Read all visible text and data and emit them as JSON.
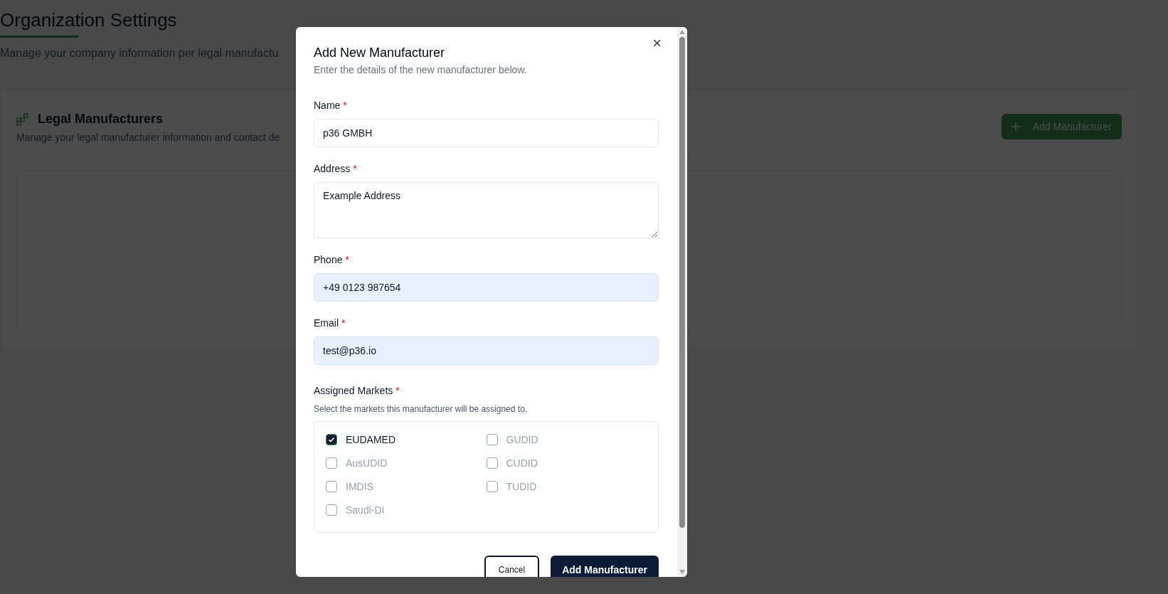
{
  "page": {
    "title": "Organization Settings",
    "subtitle": "Manage your company information per legal manufactu"
  },
  "card": {
    "title": "Legal Manufacturers",
    "subtitle": "Manage your legal manufacturer information and contact de",
    "button": "Add Manufacturer"
  },
  "dialog": {
    "title": "Add New Manufacturer",
    "subtitle": "Enter the details of the new manufacturer below.",
    "close": "×",
    "fields": [
      {
        "kind": "input",
        "label": "Name",
        "required_mark": "*",
        "value": "p36 GMBH",
        "autofilled": false
      },
      {
        "kind": "textarea",
        "label": "Address",
        "required_mark": "*",
        "value": "Example Address",
        "autofilled": false
      },
      {
        "kind": "input",
        "label": "Phone",
        "required_mark": "*",
        "value": "+49 0123 987654",
        "autofilled": true
      },
      {
        "kind": "input",
        "label": "Email",
        "required_mark": "*",
        "value": "test@p36.io",
        "autofilled": true
      }
    ],
    "markets": {
      "label": "Assigned Markets",
      "required_mark": "*",
      "help": "Select the markets this manufacturer will be assigned to.",
      "options": [
        {
          "label": "EUDAMED",
          "checked": true
        },
        {
          "label": "GUDID",
          "checked": false
        },
        {
          "label": "AusUDID",
          "checked": false
        },
        {
          "label": "CUDID",
          "checked": false
        },
        {
          "label": "IMDIS",
          "checked": false
        },
        {
          "label": "TUDID",
          "checked": false
        },
        {
          "label": "Saudi-DI",
          "checked": false
        }
      ]
    },
    "buttons": [
      {
        "kind": "secondary",
        "label": "Cancel"
      },
      {
        "kind": "primary",
        "label": "Add Manufacturer"
      }
    ]
  }
}
